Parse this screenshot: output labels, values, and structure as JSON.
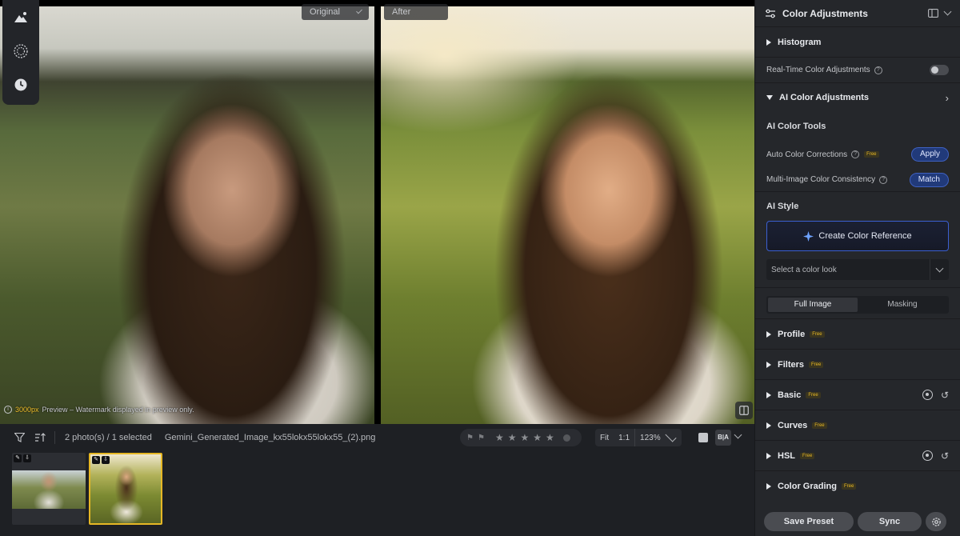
{
  "viewer": {
    "original_label": "Original",
    "after_label": "After",
    "preview_size": "3000px",
    "preview_note": "Preview – Watermark displayed in preview only."
  },
  "left_tools": [
    {
      "icon": "mountain-adjust-icon"
    },
    {
      "icon": "grain-circle-icon"
    },
    {
      "icon": "history-clock-icon"
    }
  ],
  "filmbar": {
    "photo_count": "2 photo(s) / 1 selected",
    "file_name": "Gemini_Generated_Image_kx55lokx55lokx55_(2).png",
    "zoom_fit": "Fit",
    "zoom_1to1": "1:1",
    "zoom_value": "123%",
    "view_ba": "B|A"
  },
  "panel": {
    "title": "Color Adjustments",
    "histogram": "Histogram",
    "realtime_label": "Real-Time Color Adjustments",
    "ai_section": "AI Color Adjustments",
    "ai_tools_title": "AI Color Tools",
    "auto_label": "Auto Color Corrections",
    "free": "Free",
    "apply": "Apply",
    "multi_label": "Multi-Image Color Consistency",
    "match": "Match",
    "ai_style_title": "AI Style",
    "create_ref": "Create Color Reference",
    "select_look": "Select a color look",
    "tab_full": "Full Image",
    "tab_masking": "Masking",
    "sections": [
      {
        "label": "Profile",
        "free": "Free"
      },
      {
        "label": "Filters",
        "free": "Free"
      },
      {
        "label": "Basic",
        "free": "Free"
      },
      {
        "label": "Curves",
        "free": "Free"
      },
      {
        "label": "HSL",
        "free": "Free"
      },
      {
        "label": "Color Grading",
        "free": "Free"
      }
    ],
    "save_preset": "Save Preset",
    "sync": "Sync"
  }
}
